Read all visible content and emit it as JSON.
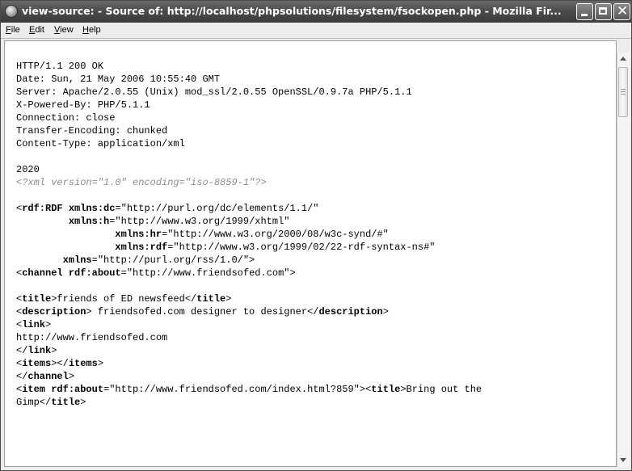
{
  "window": {
    "title": "view-source: - Source of: http://localhost/phpsolutions/filesystem/fsockopen.php - Mozilla Fir..."
  },
  "menu": {
    "items": [
      {
        "accel": "F",
        "rest": "ile"
      },
      {
        "accel": "E",
        "rest": "dit"
      },
      {
        "accel": "V",
        "rest": "iew"
      },
      {
        "accel": "H",
        "rest": "elp"
      }
    ]
  },
  "source": {
    "lines": [
      [
        {
          "t": "HTTP/1.1 200 OK"
        }
      ],
      [
        {
          "t": "Date: Sun, 21 May 2006 10:55:40 GMT"
        }
      ],
      [
        {
          "t": "Server: Apache/2.0.55 (Unix) mod_ssl/2.0.55 OpenSSL/0.9.7a PHP/5.1.1"
        }
      ],
      [
        {
          "t": "X-Powered-By: PHP/5.1.1"
        }
      ],
      [
        {
          "t": "Connection: close"
        }
      ],
      [
        {
          "t": "Transfer-Encoding: chunked"
        }
      ],
      [
        {
          "t": "Content-Type: application/xml"
        }
      ],
      [],
      [
        {
          "t": "2020"
        }
      ],
      [
        {
          "t": "<?xml version=\"1.0\" encoding=\"iso-8859-1\"?>",
          "s": "pi"
        }
      ],
      [],
      [
        {
          "t": "<"
        },
        {
          "t": "rdf:RDF",
          "s": "b"
        },
        {
          "t": " "
        },
        {
          "t": "xmlns:dc",
          "s": "b"
        },
        {
          "t": "=\"http://purl.org/dc/elements/1.1/\""
        }
      ],
      [
        {
          "t": "         "
        },
        {
          "t": "xmlns:h",
          "s": "b"
        },
        {
          "t": "=\"http://www.w3.org/1999/xhtml\""
        }
      ],
      [
        {
          "t": "                 "
        },
        {
          "t": "xmlns:hr",
          "s": "b"
        },
        {
          "t": "=\"http://www.w3.org/2000/08/w3c-synd/#\""
        }
      ],
      [
        {
          "t": "                 "
        },
        {
          "t": "xmlns:rdf",
          "s": "b"
        },
        {
          "t": "=\"http://www.w3.org/1999/02/22-rdf-syntax-ns#\""
        }
      ],
      [
        {
          "t": "        "
        },
        {
          "t": "xmlns",
          "s": "b"
        },
        {
          "t": "=\"http://purl.org/rss/1.0/\">"
        }
      ],
      [
        {
          "t": "<"
        },
        {
          "t": "channel",
          "s": "b"
        },
        {
          "t": " "
        },
        {
          "t": "rdf:about",
          "s": "b"
        },
        {
          "t": "=\"http://www.friendsofed.com\">"
        }
      ],
      [],
      [
        {
          "t": "<"
        },
        {
          "t": "title",
          "s": "b"
        },
        {
          "t": ">friends of ED newsfeed</"
        },
        {
          "t": "title",
          "s": "b"
        },
        {
          "t": ">"
        }
      ],
      [
        {
          "t": "<"
        },
        {
          "t": "description",
          "s": "b"
        },
        {
          "t": "> friendsofed.com designer to designer</"
        },
        {
          "t": "description",
          "s": "b"
        },
        {
          "t": ">"
        }
      ],
      [
        {
          "t": "<"
        },
        {
          "t": "link",
          "s": "b"
        },
        {
          "t": ">"
        }
      ],
      [
        {
          "t": "http://www.friendsofed.com"
        }
      ],
      [
        {
          "t": "</"
        },
        {
          "t": "link",
          "s": "b"
        },
        {
          "t": ">"
        }
      ],
      [
        {
          "t": "<"
        },
        {
          "t": "items",
          "s": "b"
        },
        {
          "t": "></"
        },
        {
          "t": "items",
          "s": "b"
        },
        {
          "t": ">"
        }
      ],
      [
        {
          "t": "</"
        },
        {
          "t": "channel",
          "s": "b"
        },
        {
          "t": ">"
        }
      ],
      [
        {
          "t": "<"
        },
        {
          "t": "item",
          "s": "b"
        },
        {
          "t": " "
        },
        {
          "t": "rdf:about",
          "s": "b"
        },
        {
          "t": "=\"http://www.friendsofed.com/index.html?859\"><"
        },
        {
          "t": "title",
          "s": "b"
        },
        {
          "t": ">Bring out the"
        }
      ],
      [
        {
          "t": "Gimp</"
        },
        {
          "t": "title",
          "s": "b"
        },
        {
          "t": ">"
        }
      ]
    ]
  }
}
